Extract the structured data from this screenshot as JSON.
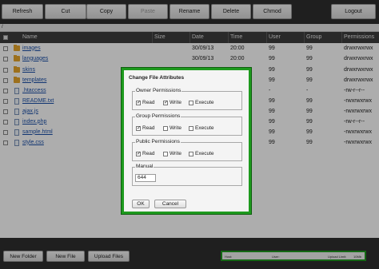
{
  "toolbar": {
    "buttons": [
      {
        "label": "Refresh",
        "enabled": true
      },
      {
        "label": "Cut",
        "enabled": true
      },
      {
        "label": "Copy",
        "enabled": true
      },
      {
        "label": "Paste",
        "enabled": false
      },
      {
        "label": "Rename",
        "enabled": true
      },
      {
        "label": "Delete",
        "enabled": true
      },
      {
        "label": "Chmod",
        "enabled": true
      },
      {
        "label": "Logout",
        "enabled": true
      }
    ]
  },
  "path": "/",
  "columns": {
    "name": "Name",
    "size": "Size",
    "date": "Date",
    "time": "Time",
    "user": "User",
    "group": "Group",
    "permissions": "Permissions"
  },
  "files": [
    {
      "name": "images",
      "type": "folder",
      "size": "",
      "date": "30/09/13",
      "time": "20:00",
      "user": "99",
      "group": "99",
      "permissions": "drwxrwxrwx"
    },
    {
      "name": "languages",
      "type": "folder",
      "size": "",
      "date": "30/09/13",
      "time": "20:00",
      "user": "99",
      "group": "99",
      "permissions": "drwxrwxrwx"
    },
    {
      "name": "skins",
      "type": "folder",
      "size": "",
      "date": "",
      "time": "",
      "user": "99",
      "group": "99",
      "permissions": "drwxrwxrwx"
    },
    {
      "name": "templates",
      "type": "folder",
      "size": "",
      "date": "",
      "time": "",
      "user": "99",
      "group": "99",
      "permissions": "drwxrwxrwx"
    },
    {
      "name": ".htaccess",
      "type": "file",
      "size": "",
      "date": "",
      "time": "",
      "user": "-",
      "group": "-",
      "permissions": "-rw-r--r--"
    },
    {
      "name": "README.txt",
      "type": "file",
      "size": "",
      "date": "",
      "time": "",
      "user": "99",
      "group": "99",
      "permissions": "-rwxrwxrwx"
    },
    {
      "name": "ajax.js",
      "type": "file",
      "size": "",
      "date": "",
      "time": "",
      "user": "99",
      "group": "99",
      "permissions": "-rwxrwxrwx"
    },
    {
      "name": "index.php",
      "type": "file",
      "size": "",
      "date": "",
      "time": "",
      "user": "99",
      "group": "99",
      "permissions": "-rw-r--r--"
    },
    {
      "name": "sample.html",
      "type": "file",
      "size": "",
      "date": "",
      "time": "",
      "user": "99",
      "group": "99",
      "permissions": "-rwxrwxrwx"
    },
    {
      "name": "style.css",
      "type": "file",
      "size": "",
      "date": "",
      "time": "",
      "user": "99",
      "group": "99",
      "permissions": "-rwxrwxrwx"
    }
  ],
  "footer": {
    "new_folder": "New Folder",
    "new_file": "New File",
    "upload_files": "Upload Files",
    "host_label": "Host:",
    "user_label": "User:",
    "upload_limit_label": "Upload Limit:",
    "upload_limit_value": "10Mb"
  },
  "dialog": {
    "title": "Change File Attributes",
    "groups": [
      {
        "legend": "Owner Permissions",
        "read": true,
        "write": true,
        "execute": false
      },
      {
        "legend": "Group Permissions",
        "read": true,
        "write": false,
        "execute": false
      },
      {
        "legend": "Public Permissions",
        "read": true,
        "write": false,
        "execute": false
      }
    ],
    "labels": {
      "read": "Read",
      "write": "Write",
      "execute": "Execute"
    },
    "manual_legend": "Manual",
    "manual_value": "644",
    "ok": "OK",
    "cancel": "Cancel"
  },
  "colors": {
    "accent": "#1e9a1e",
    "toolbar": "#2e2e2e",
    "link": "#1a4fa8",
    "folder": "#e6a52c"
  }
}
